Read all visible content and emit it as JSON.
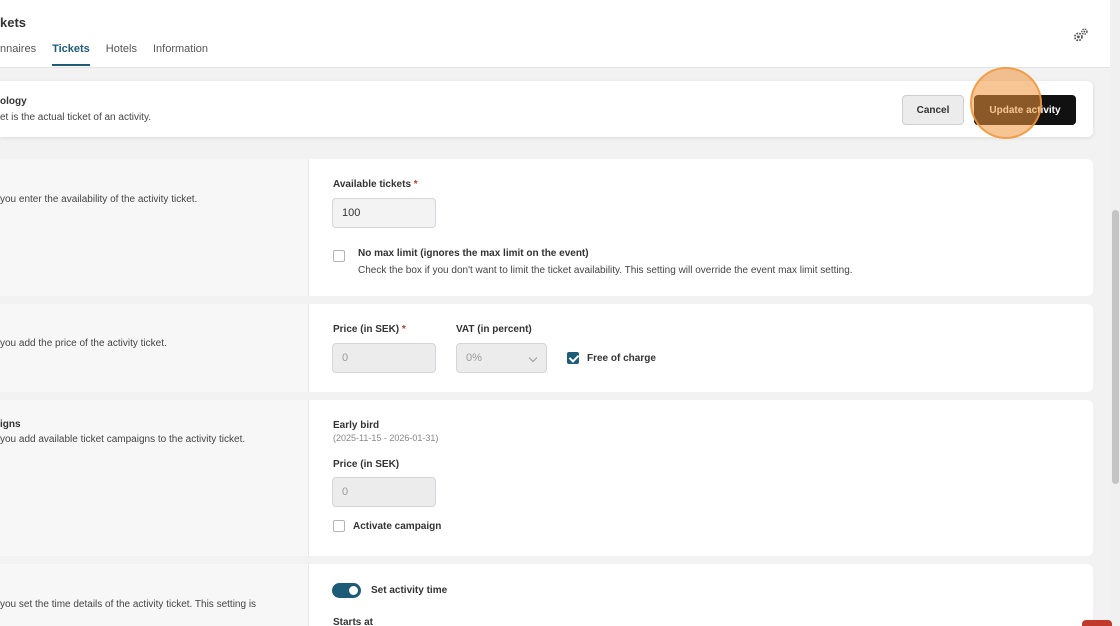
{
  "header": {
    "title": "kets",
    "tabs": [
      {
        "label": "nnaires",
        "active": false
      },
      {
        "label": "Tickets",
        "active": true
      },
      {
        "label": "Hotels",
        "active": false
      },
      {
        "label": "Information",
        "active": false
      }
    ],
    "settings_icon": "gears-icon"
  },
  "action_bar": {
    "title": "ology",
    "subtitle": "et is the actual ticket of an activity.",
    "cancel_label": "Cancel",
    "update_label": "Update activity"
  },
  "availability": {
    "description": "you enter the availability of the activity ticket.",
    "label": "Available tickets",
    "required_mark": "*",
    "value": "100",
    "no_max_title": "No max limit (ignores the max limit on the event)",
    "no_max_help": "Check the box if you don't want to limit the ticket availability. This setting will override the event max limit setting.",
    "no_max_checked": false
  },
  "price": {
    "description": "you add the price of the activity ticket.",
    "price_label": "Price (in SEK)",
    "required_mark": "*",
    "price_value": "0",
    "vat_label": "VAT (in percent)",
    "vat_value": "0%",
    "free_label": "Free of charge",
    "free_checked": true
  },
  "campaigns": {
    "title": "igns",
    "description": "you add available ticket campaigns to the activity ticket.",
    "campaign_name": "Early bird",
    "campaign_dates": "(2025-11-15 - 2026-01-31)",
    "price_label": "Price (in SEK)",
    "price_value": "0",
    "activate_label": "Activate campaign",
    "activate_checked": false
  },
  "time": {
    "description": "you set the time details of the activity ticket. This setting is",
    "toggle_label": "Set activity time",
    "toggle_on": true,
    "starts_label": "Starts at"
  },
  "colors": {
    "accent": "#1d5c77",
    "primary_button": "#111111",
    "click_highlight": "#f0963c"
  }
}
